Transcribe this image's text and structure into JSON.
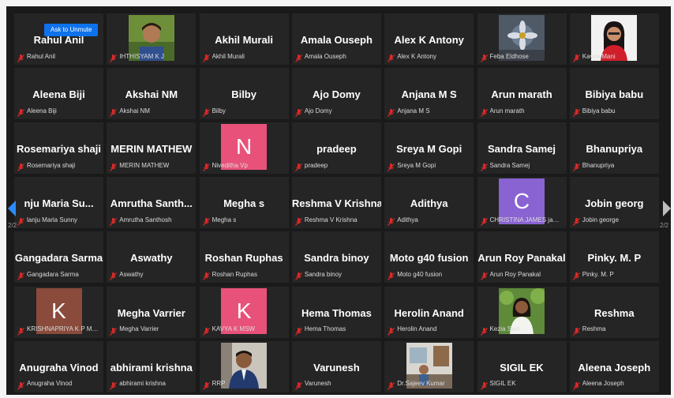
{
  "controls": {
    "ask_unmute": "Ask to Unmute",
    "more": "···"
  },
  "pagination": {
    "left": "2/2",
    "right": "2/2"
  },
  "colors": {
    "tile_bg": "#252525",
    "mic_red": "#e02828",
    "avatar_pink": "#e8527a",
    "avatar_purple": "#8a63d2",
    "avatar_brown": "#8a4a3c"
  },
  "participants": [
    {
      "name": "Rahul Anil",
      "label": "Rahul Anil",
      "has_controls": true
    },
    {
      "name": "",
      "label": "IHTHISYAM K J",
      "photo": "photo-man-green"
    },
    {
      "name": "Akhil Murali",
      "label": "Akhil Murali"
    },
    {
      "name": "Amala Ouseph",
      "label": "Amala Ouseph"
    },
    {
      "name": "Alex K Antony",
      "label": "Alex K Antony"
    },
    {
      "name": "",
      "label": "Feba Eldhose",
      "photo": "photo-flower"
    },
    {
      "name": "",
      "label": "Kavya Mani",
      "photo": "photo-woman-red"
    },
    {
      "name": "Aleena Biji",
      "label": "Aleena Biji"
    },
    {
      "name": "Akshai NM",
      "label": "Akshai NM"
    },
    {
      "name": "Bilby",
      "label": "Bilby"
    },
    {
      "name": "Ajo Domy",
      "label": "Ajo Domy"
    },
    {
      "name": "Anjana M S",
      "label": "Anjana M S"
    },
    {
      "name": "Arun marath",
      "label": "Arun marath"
    },
    {
      "name": "Bibiya babu",
      "label": "Bibiya babu"
    },
    {
      "name": "Rosemariya shaji",
      "label": "Rosemariya shaji"
    },
    {
      "name": "MERIN MATHEW",
      "label": "MERIN MATHEW"
    },
    {
      "name": "",
      "label": "Niveditha Vp",
      "avatar": "N",
      "avatar_color": "#e8527a"
    },
    {
      "name": "pradeep",
      "label": "pradeep"
    },
    {
      "name": "Sreya M Gopi",
      "label": "Sreya M Gopi"
    },
    {
      "name": "Sandra Samej",
      "label": "Sandra Samej"
    },
    {
      "name": "Bhanupriya",
      "label": "Bhanupriya"
    },
    {
      "name": "nju Maria Su...",
      "label": "lanju Maria Sunny"
    },
    {
      "name": "Amrutha  Santh...",
      "label": "Amrutha Santhosh"
    },
    {
      "name": "Megha s",
      "label": "Megha s"
    },
    {
      "name": "Reshma V Krishna",
      "label": "Reshma V Krishna"
    },
    {
      "name": "Adithya",
      "label": "Adithya"
    },
    {
      "name": "",
      "label": "CHRISTINA JAMES jam...",
      "avatar": "C",
      "avatar_color": "#8a63d2"
    },
    {
      "name": "Jobin georg",
      "label": "Jobin george"
    },
    {
      "name": "Gangadara Sarma",
      "label": "Gangadara Sarma"
    },
    {
      "name": "Aswathy",
      "label": "Aswathy"
    },
    {
      "name": "Roshan Ruphas",
      "label": "Roshan Ruphas"
    },
    {
      "name": "Sandra binoy",
      "label": "Sandra binoy"
    },
    {
      "name": "Moto g40 fusion",
      "label": "Moto g40 fusion"
    },
    {
      "name": "Arun Roy Panakal",
      "label": "Arun Roy Panakal"
    },
    {
      "name": "Pinky. M. P",
      "label": "Pinky. M. P"
    },
    {
      "name": "",
      "label": "KRISHNAPRIYA K P MS...",
      "avatar": "K",
      "avatar_color": "#8a4a3c"
    },
    {
      "name": "Megha Varrier",
      "label": "Megha Varrier"
    },
    {
      "name": "",
      "label": "KAVYA K MSW",
      "avatar": "K",
      "avatar_color": "#e8527a"
    },
    {
      "name": "Hema Thomas",
      "label": "Hema Thomas"
    },
    {
      "name": "Herolin Anand",
      "label": "Herolin Anand"
    },
    {
      "name": "",
      "label": "Kezia Sam",
      "photo": "photo-woman-garden"
    },
    {
      "name": "Reshma",
      "label": "Reshma"
    },
    {
      "name": "Anugraha Vinod",
      "label": "Anugraha Vinod"
    },
    {
      "name": "abhirami krishna",
      "label": "abhirami krishna"
    },
    {
      "name": "",
      "label": "RRP",
      "photo": "photo-man-blue"
    },
    {
      "name": "Varunesh",
      "label": "Varunesh"
    },
    {
      "name": "",
      "label": "Dr.Sajeev Kumar",
      "photo": "photo-room"
    },
    {
      "name": "SIGIL EK",
      "label": "SIGIL EK"
    },
    {
      "name": "Aleena Joseph",
      "label": "Aleena Joseph"
    }
  ]
}
